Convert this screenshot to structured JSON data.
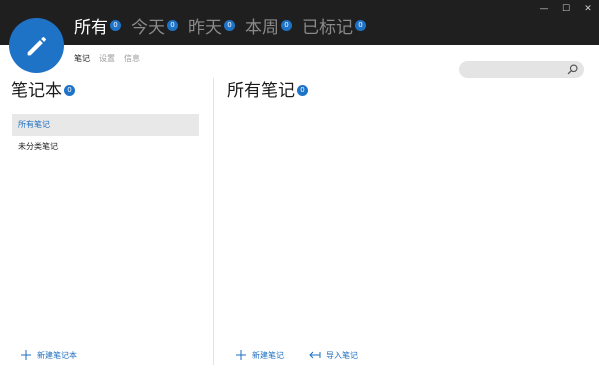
{
  "header": {
    "filters": [
      {
        "label": "所有",
        "count": "0"
      },
      {
        "label": "今天",
        "count": "0"
      },
      {
        "label": "昨天",
        "count": "0"
      },
      {
        "label": "本周",
        "count": "0"
      },
      {
        "label": "已标记",
        "count": "0"
      }
    ],
    "subtabs": [
      "笔记",
      "设置",
      "信息"
    ],
    "window_controls": {
      "minimize": "—",
      "maximize": "☐",
      "close": "✕"
    }
  },
  "search": {
    "placeholder": "",
    "value": ""
  },
  "notebooks": {
    "title": "笔记本",
    "count": "0",
    "items": [
      "所有笔记",
      "未分类笔记"
    ],
    "new_label": "新建笔记本"
  },
  "notes": {
    "title": "所有笔记",
    "count": "0",
    "new_label": "新建笔记",
    "import_label": "导入笔记"
  },
  "colors": {
    "accent": "#1e73c7",
    "topbar": "#1f1f1f"
  }
}
